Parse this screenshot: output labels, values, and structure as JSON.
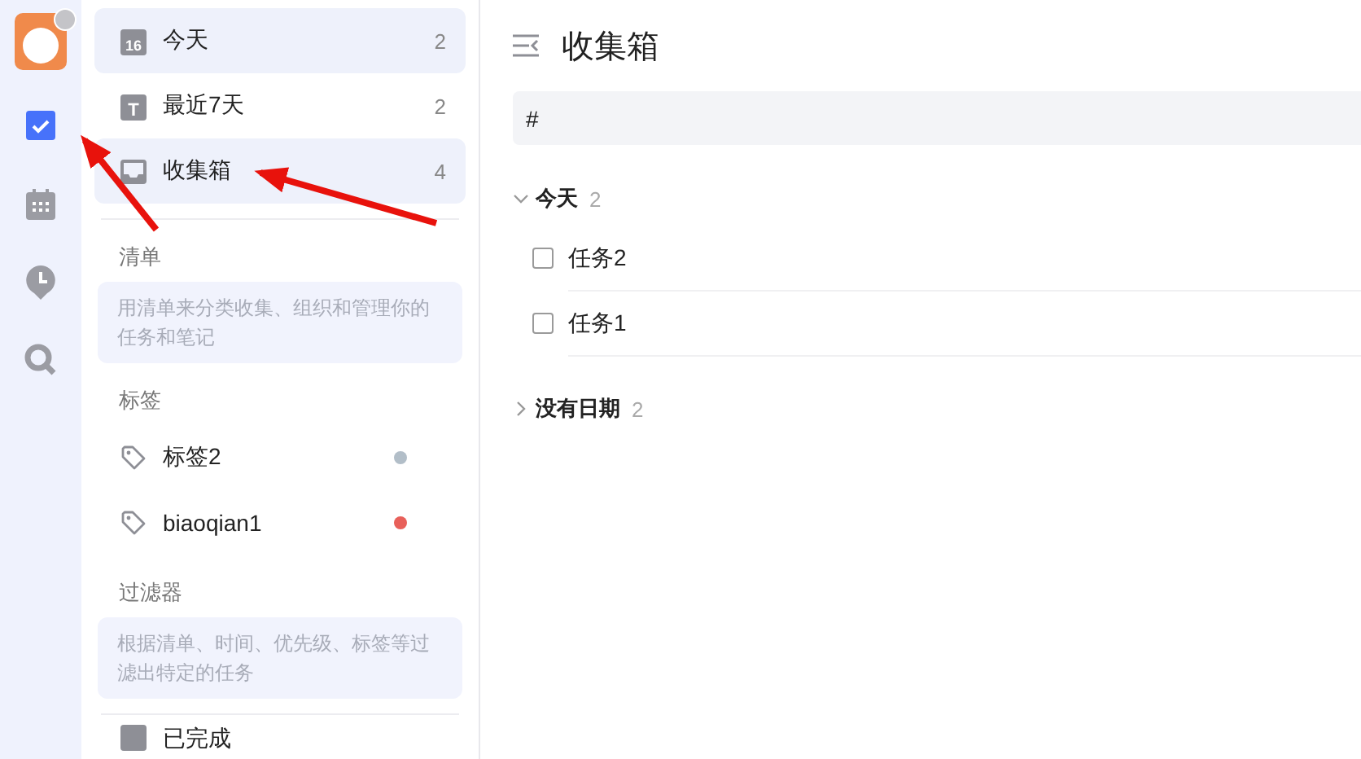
{
  "rail": {
    "items": [
      {
        "kind": "tasks",
        "selected": true
      },
      {
        "kind": "calendar",
        "selected": false
      },
      {
        "kind": "clock",
        "selected": false
      },
      {
        "kind": "search",
        "selected": false
      }
    ]
  },
  "sidebar": {
    "smart_lists": [
      {
        "label": "今天",
        "count": "2",
        "icon_text": "16",
        "selected": true
      },
      {
        "label": "最近7天",
        "count": "2",
        "icon_text": "T",
        "selected": false
      },
      {
        "label": "收集箱",
        "count": "4",
        "selected": true
      }
    ],
    "lists_header": "清单",
    "lists_hint": "用清单来分类收集、组织和管理你的任务和笔记",
    "tags_header": "标签",
    "tags": [
      {
        "label": "标签2",
        "color": "#b2bec8"
      },
      {
        "label": "biaoqian1",
        "color": "#e8605a"
      }
    ],
    "filters_header": "过滤器",
    "filters_hint": "根据清单、时间、优先级、标签等过滤出特定的任务",
    "completed": {
      "label": "已完成"
    }
  },
  "main": {
    "title": "收集箱",
    "add_task": {
      "value": "#"
    },
    "groups": [
      {
        "label": "今天",
        "count": "2",
        "expanded": true,
        "tasks": [
          {
            "title": "任务2",
            "checked": false
          },
          {
            "title": "任务1",
            "checked": false
          }
        ]
      },
      {
        "label": "没有日期",
        "count": "2",
        "expanded": false
      }
    ]
  }
}
